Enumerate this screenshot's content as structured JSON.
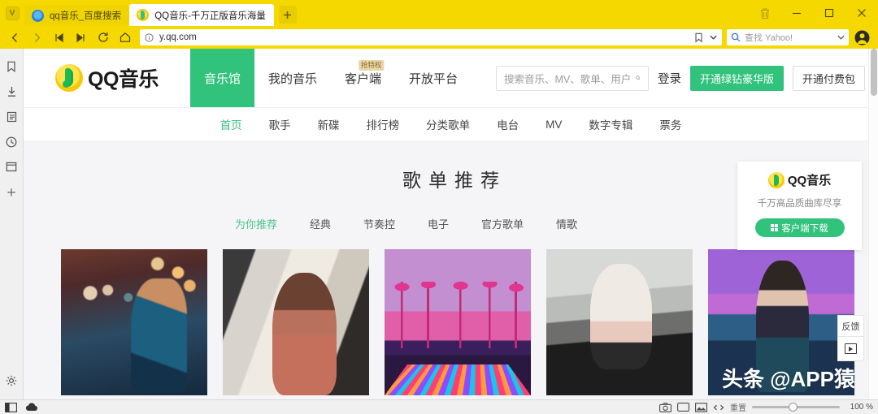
{
  "browser": {
    "app_icon": "vivaldi-icon",
    "tabs": [
      {
        "title": "qq音乐_百度搜索",
        "favicon": "baidu-favicon",
        "active": false
      },
      {
        "title": "QQ音乐-千万正版音乐海量",
        "favicon": "qqmusic-favicon",
        "active": true
      }
    ],
    "new_tab_label": "+",
    "window_controls": {
      "trash": "trash-icon",
      "minimize": "–",
      "maximize": "▫",
      "close": "✕"
    },
    "toolbar": {
      "back": "back-icon",
      "forward": "forward-icon",
      "rewind": "rewind-icon",
      "fastforward": "fastforward-icon",
      "reload": "reload-icon",
      "home": "home-icon",
      "url": "y.qq.com",
      "info": "info-icon",
      "bookmark": "bookmark-icon",
      "bookmark_dropdown": "chevron-down-icon",
      "search_placeholder": "查找 Yahoo!",
      "search_dropdown": "chevron-down-icon",
      "profile": "profile-icon"
    },
    "sidebar": {
      "items": [
        {
          "name": "bookmarks",
          "icon": "bookmark-icon"
        },
        {
          "name": "downloads",
          "icon": "download-icon"
        },
        {
          "name": "notes",
          "icon": "notes-icon"
        },
        {
          "name": "history",
          "icon": "clock-icon"
        },
        {
          "name": "window-panel",
          "icon": "window-icon"
        },
        {
          "name": "add-panel",
          "icon": "plus-icon"
        }
      ],
      "settings_icon": "gear-icon"
    },
    "statusbar": {
      "left_icons": [
        "panel-toggle-icon",
        "cloud-icon"
      ],
      "right_icons": [
        "capture-icon",
        "tiling-icon",
        "image-toggle-icon",
        "animation-icon"
      ],
      "reset_label": "重置",
      "zoom_value": "100 %",
      "zoom_percent": 100
    }
  },
  "site": {
    "brand": {
      "name": "QQ音乐",
      "logo": "qqmusic-logo"
    },
    "topnav": [
      {
        "label": "音乐馆",
        "active": true
      },
      {
        "label": "我的音乐",
        "active": false
      },
      {
        "label": "客户端",
        "active": false,
        "badge": "抢特权"
      },
      {
        "label": "开放平台",
        "active": false
      }
    ],
    "search": {
      "placeholder": "搜索音乐、MV、歌单、用户",
      "icon": "search-icon"
    },
    "actions": {
      "login": "登录",
      "green_vip": "开通绿钻豪华版",
      "paid_pack": "开通付费包"
    },
    "subnav": [
      {
        "label": "首页",
        "active": true
      },
      {
        "label": "歌手",
        "active": false
      },
      {
        "label": "新碟",
        "active": false
      },
      {
        "label": "排行榜",
        "active": false
      },
      {
        "label": "分类歌单",
        "active": false
      },
      {
        "label": "电台",
        "active": false
      },
      {
        "label": "MV",
        "active": false
      },
      {
        "label": "数字专辑",
        "active": false
      },
      {
        "label": "票务",
        "active": false
      }
    ],
    "section": {
      "title": "歌单推荐",
      "filters": [
        {
          "label": "为你推荐",
          "active": true
        },
        {
          "label": "经典",
          "active": false
        },
        {
          "label": "节奏控",
          "active": false
        },
        {
          "label": "电子",
          "active": false
        },
        {
          "label": "官方歌单",
          "active": false
        },
        {
          "label": "情歌",
          "active": false
        }
      ],
      "cards": [
        {
          "name": "playlist-card-1"
        },
        {
          "name": "playlist-card-2"
        },
        {
          "name": "playlist-card-3"
        },
        {
          "name": "playlist-card-4"
        },
        {
          "name": "playlist-card-5"
        }
      ]
    },
    "promo": {
      "brand": "QQ音乐",
      "tagline": "千万高品质曲库尽享",
      "button": "客户端下载",
      "button_icon": "windows-icon"
    },
    "floating": {
      "feedback": "反馈",
      "video_icon": "video-play-icon"
    }
  },
  "watermark": "头条 @APP猿",
  "colors": {
    "titlebar_yellow": "#f5d800",
    "qq_green": "#31c27c",
    "badge_tan": "#e8d5a8",
    "page_bg": "#f5f5f7"
  }
}
